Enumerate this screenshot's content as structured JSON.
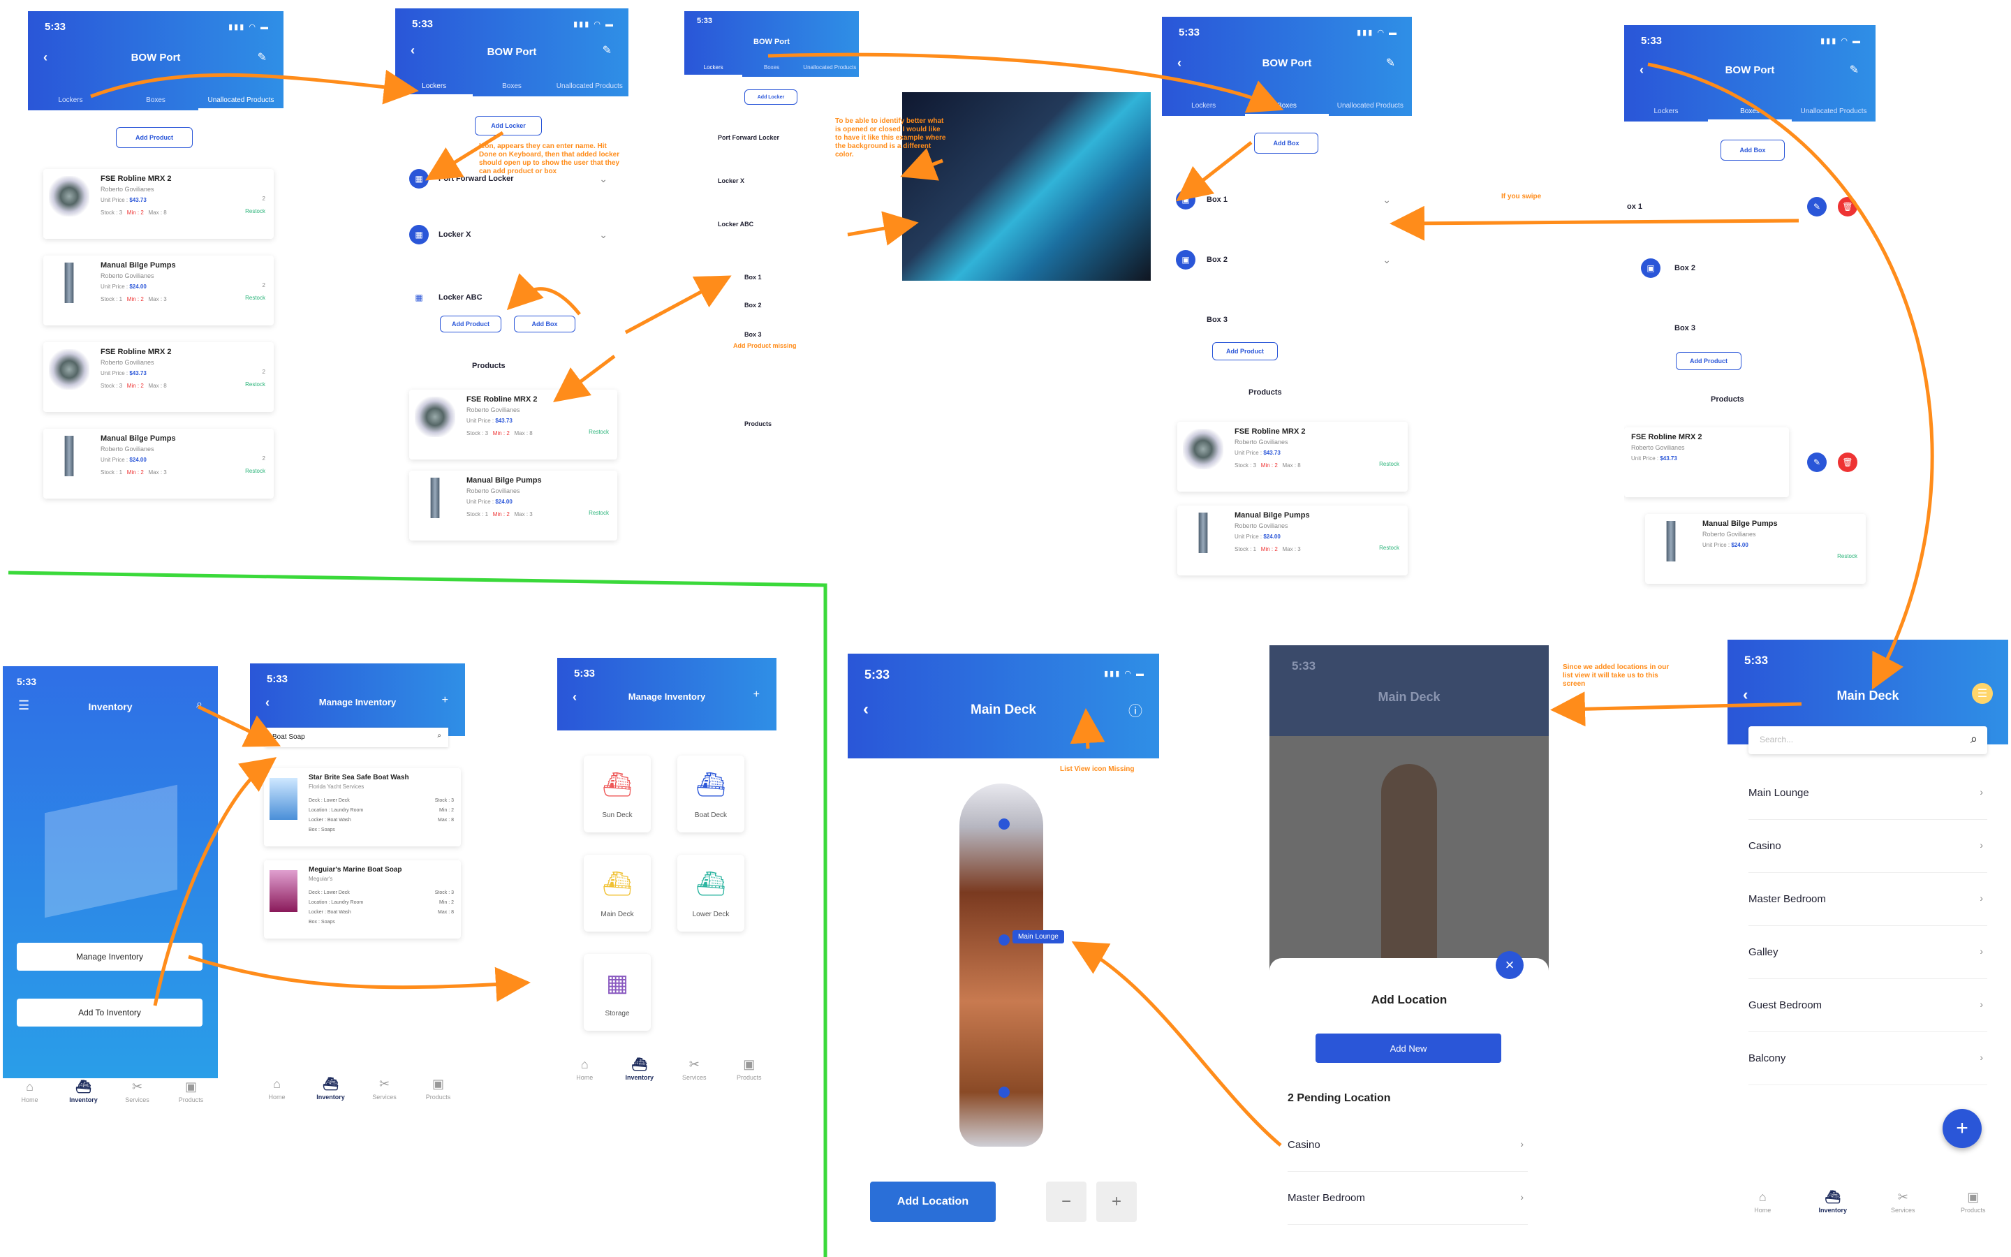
{
  "status_time": "5:33",
  "bow": {
    "title": "BOW Port",
    "tabs": [
      "Lockers",
      "Boxes",
      "Unallocated Products"
    ],
    "add_product": "Add Product",
    "add_locker": "Add Locker",
    "add_box": "Add Box"
  },
  "products": [
    {
      "name": "FSE Robline MRX 2",
      "seller": "Roberto Govilianes",
      "price_label": "Unit Price :",
      "price": "$43.73",
      "stock": "Stock : 3",
      "min": "Min : 2",
      "max": "Max : 8",
      "qty": "2",
      "restock": "Restock"
    },
    {
      "name": "Manual Bilge Pumps",
      "seller": "Roberto Govilianes",
      "price_label": "Unit Price :",
      "price": "$24.00",
      "stock": "Stock : 1",
      "min": "Min : 2",
      "max": "Max : 3",
      "qty": "2",
      "restock": "Restock"
    }
  ],
  "lockers": {
    "port_forward": "Port Forward Locker",
    "locker_x": "Locker X",
    "locker_abc": "Locker ABC",
    "products": "Products",
    "box1": "Box 1",
    "box2": "Box 2",
    "box3": "Box 3",
    "ox1": "ox 1"
  },
  "annotations": {
    "locker_hint": "Icon, appears they can enter name. Hit Done on Keyboard, then that added locker should open up to show the user that they can add product or box",
    "color_hint": "To be able to identify better what is opened or closed I would like to have it like this example where the background is a different color.",
    "missing": "Add Product missing",
    "swipe": "If you swipe",
    "list_view": "List View icon Missing",
    "locations": "Since we added locations in our list view it will take us to this screen"
  },
  "inventory": {
    "title": "Inventory",
    "manage": "Manage Inventory",
    "add": "Add To Inventory"
  },
  "manage": {
    "title": "Manage Inventory",
    "search_value": "Boat Soap",
    "items": [
      {
        "name": "Star Brite Sea Safe Boat Wash",
        "seller": "Florida Yacht Services",
        "deck": "Deck : Lower Deck",
        "location": "Location : Laundry Room",
        "locker": "Locker : Boat Wash",
        "box": "Box : Soaps",
        "stock": "Stock : 3",
        "min": "Min : 2",
        "max": "Max : 8"
      },
      {
        "name": "Meguiar's Marine Boat Soap",
        "seller": "Meguiar's",
        "deck": "Deck : Lower Deck",
        "location": "Location : Laundry Room",
        "locker": "Locker : Boat Wash",
        "box": "Box : Soaps",
        "stock": "Stock : 3",
        "min": "Min : 2",
        "max": "Max : 8"
      }
    ],
    "decks": [
      "Sun Deck",
      "Boat Deck",
      "Main Deck",
      "Lower Deck",
      "Storage"
    ]
  },
  "main_deck": {
    "title": "Main Deck",
    "marker": "Main Lounge",
    "add_location": "Add Location",
    "minus": "−",
    "plus": "+"
  },
  "add_location_sheet": {
    "title": "Add Location",
    "add_new": "Add New",
    "pending": "2 Pending Location",
    "items": [
      "Casino",
      "Master Bedroom"
    ]
  },
  "locations_list": {
    "search_placeholder": "Search...",
    "items": [
      "Main Lounge",
      "Casino",
      "Master Bedroom",
      "Galley",
      "Guest Bedroom",
      "Balcony"
    ]
  },
  "nav": [
    "Home",
    "Inventory",
    "Services",
    "Products"
  ],
  "colors": {
    "brand": "#2a56d8",
    "accent": "#ff8c1a",
    "divider": "#3ad93a",
    "danger": "#e33"
  }
}
